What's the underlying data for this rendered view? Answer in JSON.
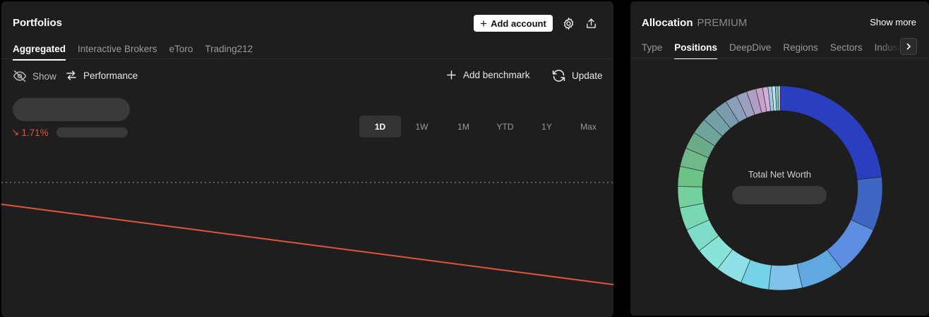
{
  "portfolios": {
    "title": "Portfolios",
    "add_account_label": "Add account",
    "tabs": [
      {
        "label": "Aggregated",
        "active": true
      },
      {
        "label": "Interactive Brokers",
        "active": false
      },
      {
        "label": "eToro",
        "active": false
      },
      {
        "label": "Trading212",
        "active": false
      }
    ],
    "toolbar": {
      "show_label": "Show",
      "performance_label": "Performance",
      "add_benchmark_label": "Add benchmark",
      "update_label": "Update"
    },
    "change": {
      "arrow": "↘",
      "value": "1.71%"
    },
    "ranges": [
      {
        "label": "1D",
        "active": true
      },
      {
        "label": "1W",
        "active": false
      },
      {
        "label": "1M",
        "active": false
      },
      {
        "label": "YTD",
        "active": false
      },
      {
        "label": "1Y",
        "active": false
      },
      {
        "label": "Max",
        "active": false
      }
    ]
  },
  "allocation": {
    "title": "Allocation",
    "badge": "PREMIUM",
    "show_more_label": "Show more",
    "tabs": [
      {
        "label": "Type",
        "active": false
      },
      {
        "label": "Positions",
        "active": true
      },
      {
        "label": "DeepDive",
        "active": false
      },
      {
        "label": "Regions",
        "active": false
      },
      {
        "label": "Sectors",
        "active": false
      },
      {
        "label": "Industries",
        "active": false
      }
    ],
    "center_label": "Total Net Worth"
  },
  "colors": {
    "panel_bg": "#1e1e1e",
    "negative": "#e0533d",
    "accent_blue": "#2a3fc0"
  },
  "chart_data": {
    "type": "line",
    "series": [
      {
        "values": [
          1.0,
          0.0
        ]
      }
    ],
    "reference_line": "dashed",
    "trend": "down"
  },
  "allocation_data": {
    "type": "pie",
    "values": [
      22.0,
      8.0,
      7.5,
      6.5,
      5.0,
      4.2,
      4.0,
      3.8,
      3.6,
      3.4,
      3.2,
      3.0,
      2.8,
      2.6,
      2.4,
      2.2,
      2.0,
      1.8,
      1.6,
      1.4,
      1.0,
      0.8,
      0.6,
      0.5,
      0.4,
      0.3
    ],
    "colors": [
      "#2a3fc0",
      "#3e67c4",
      "#5b8ee0",
      "#5fa8e0",
      "#80c2ea",
      "#74d3e6",
      "#8fe0e6",
      "#88e3d8",
      "#7fdcc8",
      "#7ad8b4",
      "#74d09c",
      "#6cc488",
      "#70b88a",
      "#6aac8a",
      "#6fa49a",
      "#74a0a8",
      "#7a9cae",
      "#8aa0b8",
      "#9aa0c0",
      "#b0a0c8",
      "#c8a0c8",
      "#d0b0d8",
      "#a0c8e0",
      "#c0e0f0",
      "#60d0c0",
      "#e0e0e0"
    ]
  }
}
